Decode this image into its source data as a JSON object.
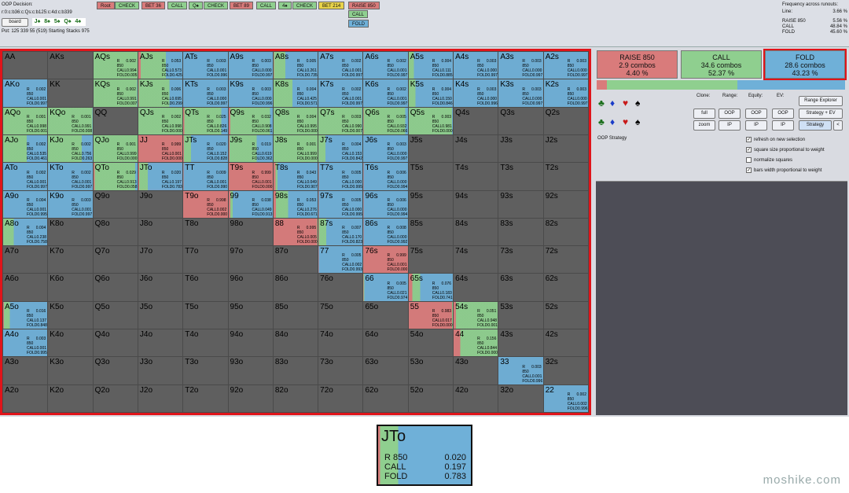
{
  "colors": {
    "raise": "#d97b7b",
    "call": "#8fcf8f",
    "fold": "#6fb0d8",
    "empty": "#5f5f5f",
    "accent": "#e0141a"
  },
  "header": {
    "title": "OOP Decision:",
    "line": "r:0:c:b36:c:Qs:c:b125:c:4d:c:b339",
    "board_button": "board",
    "board_cards": [
      "J♠",
      "8♠",
      "5♠",
      "Q♠",
      "4♠"
    ],
    "pot": "Pot: 125 339 55 (519) Starting Stacks 975"
  },
  "actions": [
    {
      "label": "Root",
      "color": "#d97b7b"
    },
    {
      "label": "CHECK",
      "color": "#8fcf8f"
    },
    {
      "label": "BET 36",
      "color": "#d97b7b"
    },
    {
      "label": "CALL",
      "color": "#8fcf8f"
    },
    {
      "label": "Q♠",
      "color": "#8fcf8f"
    },
    {
      "label": "CHECK",
      "color": "#8fcf8f"
    },
    {
      "label": "BET 89",
      "color": "#d97b7b"
    },
    {
      "label": "CALL",
      "color": "#8fcf8f"
    },
    {
      "label": "4♠",
      "color": "#8fcf8f"
    },
    {
      "label": "CHECK",
      "color": "#8fcf8f"
    },
    {
      "label": "BET 214",
      "color": "#e8d34a"
    },
    {
      "label": "RAISE 850",
      "color": "#d97b7b"
    },
    {
      "label": "CALL",
      "color": "#8fcf8f"
    },
    {
      "label": "FOLD",
      "color": "#6fb0d8"
    }
  ],
  "frequency": {
    "title": "Frequency across runouts:",
    "rows": [
      {
        "k": "Line:",
        "v": "3.66 %"
      },
      {
        "k": "",
        "v": ""
      },
      {
        "k": "RAISE 850",
        "v": "5.56 %"
      },
      {
        "k": "CALL",
        "v": "48.84 %"
      },
      {
        "k": "FOLD",
        "v": "45.60 %"
      }
    ]
  },
  "summary": [
    {
      "label": "RAISE 850",
      "combos": "2.9 combos",
      "pct": "4.40 %"
    },
    {
      "label": "CALL",
      "combos": "34.6 combos",
      "pct": "52.37 %"
    },
    {
      "label": "FOLD",
      "combos": "28.6 combos",
      "pct": "43.23 %"
    }
  ],
  "controls": {
    "clone_label": "Clone:",
    "range_label": "Range:",
    "equity_label": "Equity:",
    "ev_label": "EV:",
    "range_explorer": "Range Explorer",
    "full": "full",
    "zoom": "zoom",
    "oop": "OOP",
    "ip": "IP",
    "strategy_ev": "Strategy + EV",
    "strategy": "Strategy",
    "back": "<",
    "oop_strategy": "OOP Strategy",
    "checks": [
      {
        "label": "refresh on new selection",
        "checked": true
      },
      {
        "label": "square size proportional to weight",
        "checked": true
      },
      {
        "label": "normalize squares",
        "checked": false
      },
      {
        "label": "bars width proportional to weight",
        "checked": true
      }
    ]
  },
  "grid": [
    [
      "AA",
      "AKs",
      "AQs",
      "AJs",
      "ATs",
      "A9s",
      "A8s",
      "A7s",
      "A6s",
      "A5s",
      "A4s",
      "A3s",
      "A2s"
    ],
    [
      "AKo",
      "KK",
      "KQs",
      "KJs",
      "KTs",
      "K9s",
      "K8s",
      "K7s",
      "K6s",
      "K5s",
      "K4s",
      "K3s",
      "K2s"
    ],
    [
      "AQo",
      "KQo",
      "QQ",
      "QJs",
      "QTs",
      "Q9s",
      "Q8s",
      "Q7s",
      "Q6s",
      "Q5s",
      "Q4s",
      "Q3s",
      "Q2s"
    ],
    [
      "AJo",
      "KJo",
      "QJo",
      "JJ",
      "JTs",
      "J9s",
      "J8s",
      "J7s",
      "J6s",
      "J5s",
      "J4s",
      "J3s",
      "J2s"
    ],
    [
      "ATo",
      "KTo",
      "QTo",
      "JTo",
      "TT",
      "T9s",
      "T8s",
      "T7s",
      "T6s",
      "T5s",
      "T4s",
      "T3s",
      "T2s"
    ],
    [
      "A9o",
      "K9o",
      "Q9o",
      "J9o",
      "T9o",
      "99",
      "98s",
      "97s",
      "96s",
      "95s",
      "94s",
      "93s",
      "92s"
    ],
    [
      "A8o",
      "K8o",
      "Q8o",
      "J8o",
      "T8o",
      "98o",
      "88",
      "87s",
      "86s",
      "85s",
      "84s",
      "83s",
      "82s"
    ],
    [
      "A7o",
      "K7o",
      "Q7o",
      "J7o",
      "T7o",
      "97o",
      "87o",
      "77",
      "76s",
      "75s",
      "74s",
      "73s",
      "72s"
    ],
    [
      "A6o",
      "K6o",
      "Q6o",
      "J6o",
      "T6o",
      "96o",
      "86o",
      "76o",
      "66",
      "65s",
      "64s",
      "63s",
      "62s"
    ],
    [
      "A5o",
      "K5o",
      "Q5o",
      "J5o",
      "T5o",
      "95o",
      "85o",
      "75o",
      "65o",
      "55",
      "54s",
      "53s",
      "52s"
    ],
    [
      "A4o",
      "K4o",
      "Q4o",
      "J4o",
      "T4o",
      "94o",
      "84o",
      "74o",
      "64o",
      "54o",
      "44",
      "43s",
      "42s"
    ],
    [
      "A3o",
      "K3o",
      "Q3o",
      "J3o",
      "T3o",
      "93o",
      "83o",
      "73o",
      "63o",
      "53o",
      "43o",
      "33",
      "32s"
    ],
    [
      "A2o",
      "K2o",
      "Q2o",
      "J2o",
      "T2o",
      "92o",
      "82o",
      "72o",
      "62o",
      "52o",
      "42o",
      "32o",
      "22"
    ]
  ],
  "freqs": {
    "AQs": [
      "0.002",
      "0.994",
      "0.005"
    ],
    "AJs": [
      "0.053",
      "0.573",
      "0.425"
    ],
    "ATs": [
      "0.003",
      "0.001",
      "0.996"
    ],
    "A9s": [
      "0.003",
      "0.000",
      "0.997"
    ],
    "A8s": [
      "0.005",
      "0.261",
      "0.735"
    ],
    "A7s": [
      "0.002",
      "0.001",
      "0.997"
    ],
    "A6s": [
      "0.002",
      "0.001",
      "0.997"
    ],
    "A5s": [
      "0.004",
      "0.111",
      "0.885"
    ],
    "A4s": [
      "0.003",
      "0.000",
      "0.997"
    ],
    "A3s": [
      "0.003",
      "0.000",
      "0.997"
    ],
    "A2s": [
      "0.003",
      "0.000",
      "0.997"
    ],
    "AKo": [
      "0.002",
      "0.001",
      "0.997"
    ],
    "KQs": [
      "0.002",
      "0.991",
      "0.007"
    ],
    "KJs": [
      "0.006",
      "0.695",
      "0.299"
    ],
    "KTs": [
      "0.003",
      "0.000",
      "0.997"
    ],
    "K9s": [
      "0.003",
      "0.000",
      "0.996"
    ],
    "K8s": [
      "0.004",
      "0.425",
      "0.571"
    ],
    "K7s": [
      "0.002",
      "0.001",
      "0.997"
    ],
    "K6s": [
      "0.002",
      "0.001",
      "0.997"
    ],
    "K5s": [
      "0.004",
      "0.150",
      "0.846"
    ],
    "K4s": [
      "0.003",
      "0.000",
      "0.996"
    ],
    "K3s": [
      "0.003",
      "0.000",
      "0.997"
    ],
    "K2s": [
      "0.003",
      "0.000",
      "0.997"
    ],
    "AQo": [
      "0.001",
      "0.998",
      "0.001"
    ],
    "KQo": [
      "0.001",
      "0.991",
      "0.008"
    ],
    "QJs": [
      "0.002",
      "0.998",
      "0.000"
    ],
    "QTs": [
      "0.025",
      "0.826",
      "0.149"
    ],
    "Q9s": [
      "0.032",
      "0.908",
      "0.061"
    ],
    "Q8s": [
      "0.004",
      "0.995",
      "0.000"
    ],
    "Q7s": [
      "0.003",
      "0.990",
      "0.007"
    ],
    "Q6s": [
      "0.005",
      "0.932",
      "0.066"
    ],
    "Q5s": [
      "0.003",
      "0.981",
      "0.000"
    ],
    "AJo": [
      "0.002",
      "0.535",
      "0.461"
    ],
    "KJo": [
      "0.002",
      "0.756",
      "0.263"
    ],
    "QJo": [
      "0.001",
      "0.999",
      "0.000"
    ],
    "JJ": [
      "0.999",
      "0.001",
      "0.000"
    ],
    "JTs": [
      "0.020",
      "0.152",
      "0.828"
    ],
    "J9s": [
      "0.019",
      "0.619",
      "0.362"
    ],
    "J8s": [
      "0.001",
      "0.999",
      "0.000"
    ],
    "J7s": [
      "0.004",
      "0.153",
      "0.842"
    ],
    "J6s": [
      "0.003",
      "0.000",
      "0.997"
    ],
    "ATo": [
      "0.002",
      "0.001",
      "0.997"
    ],
    "KTo": [
      "0.002",
      "0.001",
      "0.997"
    ],
    "QTo": [
      "0.029",
      "0.913",
      "0.058"
    ],
    "JTo": [
      "0.020",
      "0.197",
      "0.783"
    ],
    "TT": [
      "0.009",
      "0.001",
      "0.990"
    ],
    "T9s": [
      "0.999",
      "0.001",
      "0.000"
    ],
    "T8s": [
      "0.043",
      "0.049",
      "0.907"
    ],
    "T7s": [
      "0.005",
      "0.000",
      "0.995"
    ],
    "T6s": [
      "0.006",
      "0.000",
      "0.994"
    ],
    "A9o": [
      "0.004",
      "0.001",
      "0.995"
    ],
    "K9o": [
      "0.003",
      "0.001",
      "0.997"
    ],
    "T9o": [
      "0.998",
      "0.002",
      "0.000"
    ],
    "99": [
      "0.038",
      "0.049",
      "0.913"
    ],
    "98s": [
      "0.053",
      "0.276",
      "0.671"
    ],
    "97s": [
      "0.005",
      "0.000",
      "0.995"
    ],
    "96s": [
      "0.006",
      "0.000",
      "0.994"
    ],
    "A8o": [
      "0.004",
      "0.238",
      "0.758"
    ],
    "88": [
      "0.995",
      "0.005",
      "0.000"
    ],
    "87s": [
      "0.007",
      "0.170",
      "0.823"
    ],
    "86s": [
      "0.008",
      "0.000",
      "0.992"
    ],
    "77": [
      "0.005",
      "0.002",
      "0.993"
    ],
    "76s": [
      "0.999",
      "0.001",
      "0.000"
    ],
    "66": [
      "0.005",
      "0.021",
      "0.974"
    ],
    "65s": [
      "0.076",
      "0.183",
      "0.741"
    ],
    "A5o": [
      "0.016",
      "0.137",
      "0.848"
    ],
    "55": [
      "0.983",
      "0.017",
      "0.000"
    ],
    "54s": [
      "0.051",
      "0.948",
      "0.001"
    ],
    "A4o": [
      "0.003",
      "0.001",
      "0.995"
    ],
    "44": [
      "0.156",
      "0.844",
      "0.000"
    ],
    "33": [
      "0.003",
      "0.001",
      "0.996"
    ],
    "22": [
      "0.002",
      "0.002",
      "0.996"
    ]
  },
  "zoom": {
    "hand": "JTo",
    "r": "0.020",
    "c": "0.197",
    "f": "0.783",
    "r_label": "R 850",
    "c_label": "CALL",
    "f_label": "FOLD"
  },
  "watermark": "moshike.com"
}
